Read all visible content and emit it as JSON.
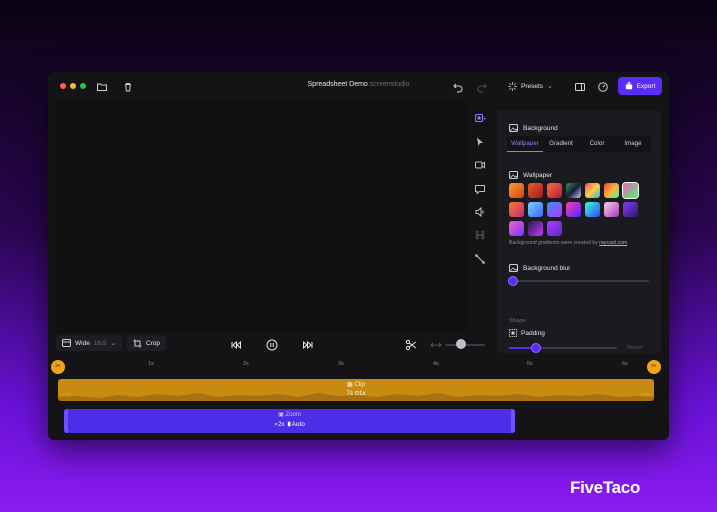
{
  "window": {
    "title": "Spreadsheet Demo",
    "title_suffix": ".screenstudio",
    "presets_label": "Presets",
    "export_label": "Export"
  },
  "panel": {
    "background_label": "Background",
    "tabs": [
      "Wallpaper",
      "Gradient",
      "Color",
      "Image"
    ],
    "active_tab": "Wallpaper",
    "wallpaper_label": "Wallpaper",
    "note_prefix": "Background gradients were created by",
    "note_link": "raycast.com",
    "blur_label": "Background blur",
    "shape_label": "Shape",
    "padding_label": "Padding",
    "reset_label": "Reset",
    "blur_value": 0,
    "padding_value": 0.25
  },
  "controls": {
    "aspect_label": "Wide",
    "aspect_ratio": "16:9",
    "crop_label": "Crop",
    "zoom_value": 0.4
  },
  "timeline": {
    "ticks": [
      "1s",
      "2s",
      "3s",
      "4s",
      "5s",
      "6s"
    ],
    "clip_label": "Clip",
    "clip_duration": "7s",
    "clip_speed": "1x",
    "clip_start": "0:00",
    "clip_end": "0:00",
    "zoom_label": "Zoom",
    "zoom_factor": "2x",
    "zoom_mode": "Auto"
  },
  "brand": "FiveTaco",
  "colors": {
    "accent": "#5a2cf5",
    "clip": "#c98a12",
    "zoom": "#4a2ee8"
  }
}
